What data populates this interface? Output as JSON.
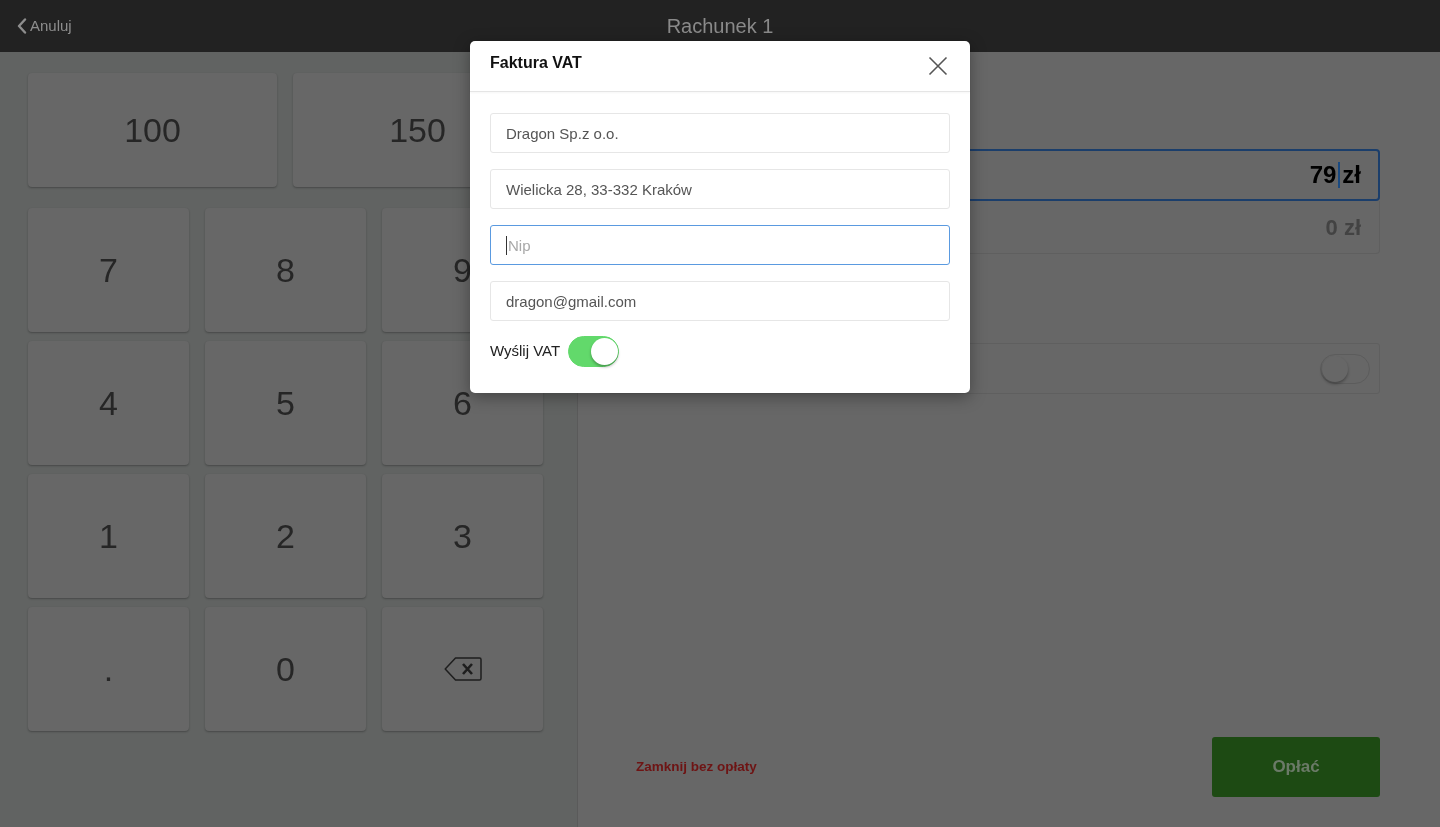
{
  "header": {
    "back_label": "Anuluj",
    "title": "Rachunek 1"
  },
  "keypad": {
    "quick_amounts": [
      "100",
      "150"
    ],
    "keys": [
      {
        "kind": "char",
        "label": "7"
      },
      {
        "kind": "char",
        "label": "8"
      },
      {
        "kind": "char",
        "label": "9"
      },
      {
        "kind": "char",
        "label": "4"
      },
      {
        "kind": "char",
        "label": "5"
      },
      {
        "kind": "char",
        "label": "6"
      },
      {
        "kind": "char",
        "label": "1"
      },
      {
        "kind": "char",
        "label": "2"
      },
      {
        "kind": "char",
        "label": "3"
      },
      {
        "kind": "char",
        "label": "."
      },
      {
        "kind": "char",
        "label": "0"
      },
      {
        "kind": "backspace"
      }
    ]
  },
  "payment": {
    "amount_field": {
      "value": "79",
      "currency": "zł",
      "focused": true
    },
    "change_field": {
      "value": "0 zł"
    },
    "toggle": {
      "on": false
    }
  },
  "actions": {
    "close_link": "Zamknij bez opłaty",
    "pay_button": "Opłać"
  },
  "modal": {
    "title": "Faktura VAT",
    "fields": [
      {
        "value": "Dragon Sp.z o.o.",
        "focused": false
      },
      {
        "value": "Wielicka 28, 33-332 Kraków",
        "focused": false
      },
      {
        "placeholder": "Nip",
        "focused": true
      },
      {
        "value": "dragon@gmail.com",
        "focused": false
      }
    ],
    "send_vat": {
      "label": "Wyślij VAT",
      "on": true
    }
  }
}
